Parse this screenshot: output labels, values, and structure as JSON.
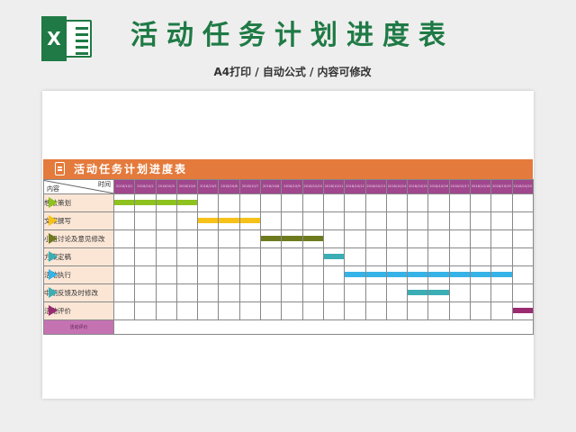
{
  "header": {
    "logo_letter": "X",
    "title": "活动任务计划进度表",
    "subtitle": "A4打印 / 自动公式 / 内容可修改"
  },
  "sheet": {
    "title": "活动任务计划进度表",
    "corner_time": "时间",
    "corner_content": "内容",
    "footer_label": "活动评价",
    "dates": [
      "2018/10/1",
      "2018/10/2",
      "2018/10/3",
      "2018/10/4",
      "2018/10/5",
      "2018/10/6",
      "2018/10/7",
      "2018/10/8",
      "2018/10/9",
      "2018/10/10",
      "2018/10/11",
      "2018/10/12",
      "2018/10/13",
      "2018/10/14",
      "2018/10/15",
      "2018/10/16",
      "2018/10/17",
      "2018/10/18",
      "2018/10/19",
      "2018/10/20"
    ],
    "tasks": [
      {
        "label": "想法策划",
        "color": "#8dc21f",
        "start": 0,
        "end": 3
      },
      {
        "label": "文案撰写",
        "color": "#f6c21a",
        "start": 4,
        "end": 6
      },
      {
        "label": "小组讨论及意见修改",
        "color": "#6e7a1e",
        "start": 7,
        "end": 9
      },
      {
        "label": "方案定稿",
        "color": "#3aaeb4",
        "start": 10,
        "end": 10
      },
      {
        "label": "活动执行",
        "color": "#35b3e6",
        "start": 11,
        "end": 18
      },
      {
        "label": "中期反馈及时修改",
        "color": "#3aaeb4",
        "start": 14,
        "end": 15
      },
      {
        "label": "活动评价",
        "color": "#9b2a72",
        "start": 19,
        "end": 19
      }
    ]
  },
  "colors": {
    "brand_green": "#1f7a45",
    "titlebar_orange": "#e47a3c",
    "date_header_purple": "#a1478e",
    "label_peach": "#fbe6d6",
    "footer_pink": "#c572b3"
  }
}
